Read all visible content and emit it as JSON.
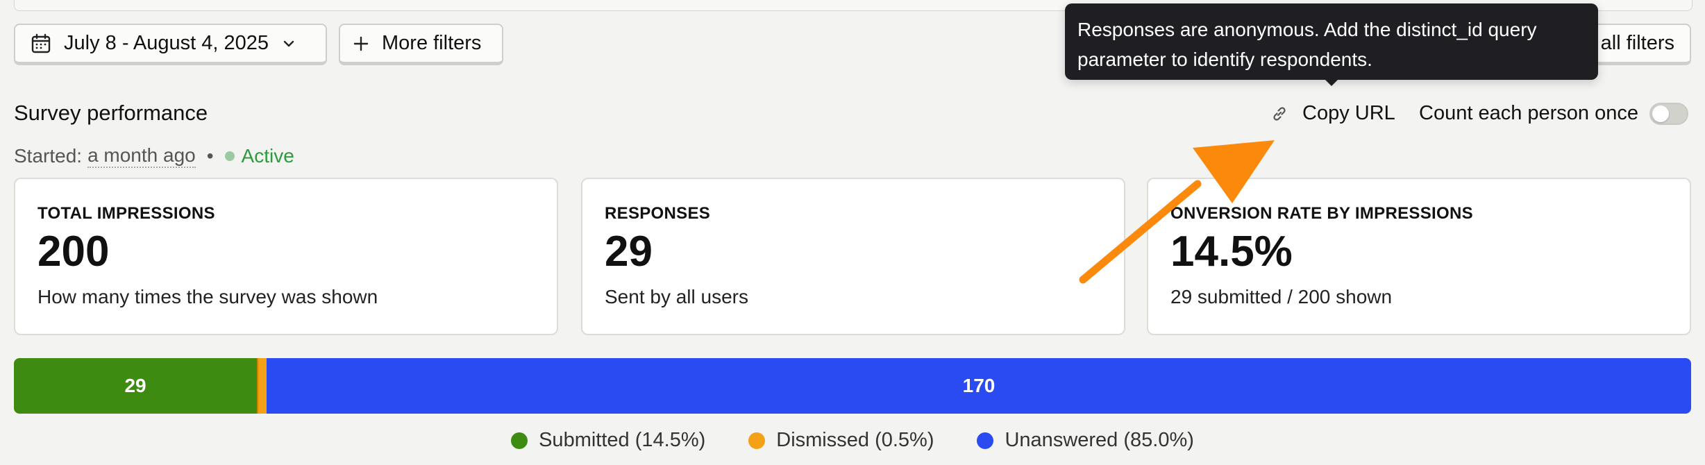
{
  "filters": {
    "date_range": "July 8 - August 4, 2025",
    "more_filters": "More filters",
    "all_filters_partial": "all filters"
  },
  "icons": {
    "calendar": "calendar-icon",
    "chevron": "chevron-down-icon",
    "plus": "plus-icon",
    "link": "link-icon"
  },
  "tooltip": {
    "text": "Responses are anonymous. Add the distinct_id query parameter to identify respondents."
  },
  "header": {
    "title": "Survey performance",
    "copy_url": "Copy URL",
    "count_once": "Count each person once",
    "count_once_enabled": false
  },
  "status": {
    "started_label": "Started:",
    "started_when": "a month ago",
    "separator": "•",
    "state": "Active",
    "color": "#2e9a3e",
    "dot_color": "#2e9a3e"
  },
  "cards": [
    {
      "label": "TOTAL IMPRESSIONS",
      "value": "200",
      "description": "How many times the survey was shown"
    },
    {
      "label": "RESPONSES",
      "value": "29",
      "description": "Sent by all users"
    },
    {
      "label": "ONVERSION RATE BY IMPRESSIONS",
      "value": "14.5%",
      "description": "29 submitted / 200 shown"
    }
  ],
  "breakdown": {
    "segments": [
      {
        "name": "Submitted",
        "count": 29,
        "percent": 14.5,
        "label": "29",
        "color": "#3d8b10"
      },
      {
        "name": "Dismissed",
        "count": 1,
        "percent": 0.5,
        "label": "",
        "color": "#f4a118"
      },
      {
        "name": "Unanswered",
        "count": 170,
        "percent": 85.0,
        "label": "170",
        "color": "#2b4bf2"
      }
    ],
    "legend": [
      {
        "label": "Submitted (14.5%)",
        "color": "#3d8b10"
      },
      {
        "label": "Dismissed (0.5%)",
        "color": "#f4a118"
      },
      {
        "label": "Unanswered (85.0%)",
        "color": "#2b4bf2"
      }
    ]
  },
  "colors": {
    "annotation_arrow": "#fb8a0c"
  }
}
